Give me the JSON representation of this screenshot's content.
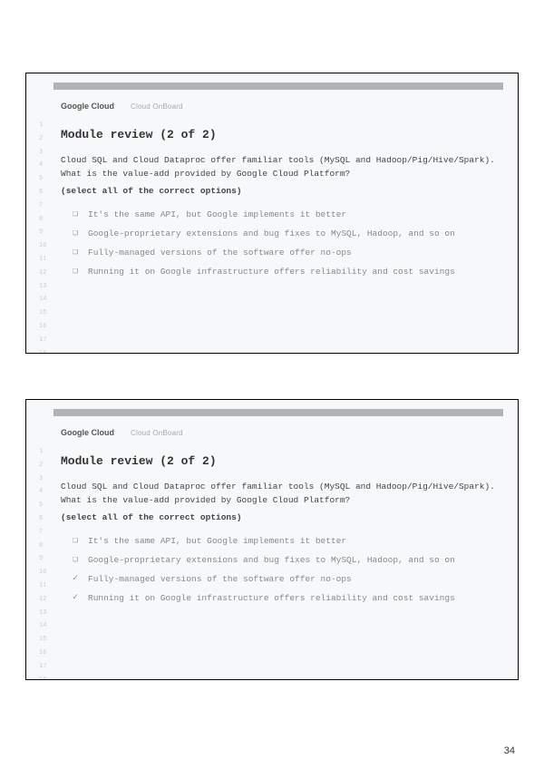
{
  "pageNumber": "34",
  "brand": {
    "main": "Google Cloud",
    "sub": "Cloud OnBoard"
  },
  "slide1": {
    "title": "Module review (2 of 2)",
    "question": "Cloud SQL and Cloud Dataproc offer familiar tools (MySQL and Hadoop/Pig/Hive/Spark). What is the value-add provided by Google Cloud Platform?",
    "instruction": "(select all of the correct options)",
    "options": [
      {
        "marker": "❏",
        "text": "It's the same API, but Google implements it better"
      },
      {
        "marker": "❏",
        "text": "Google-proprietary extensions and bug fixes to MySQL, Hadoop, and so on"
      },
      {
        "marker": "❏",
        "text": "Fully-managed versions of the software offer no-ops"
      },
      {
        "marker": "❏",
        "text": "Running it on Google infrastructure offers reliability and cost savings"
      }
    ]
  },
  "slide2": {
    "title": "Module review (2 of 2)",
    "question": "Cloud SQL and Cloud Dataproc offer familiar tools (MySQL and Hadoop/Pig/Hive/Spark). What is the value-add provided by Google Cloud Platform?",
    "instruction": "(select all of the correct options)",
    "options": [
      {
        "marker": "❏",
        "text": "It's the same API, but Google implements it better"
      },
      {
        "marker": "❏",
        "text": "Google-proprietary extensions and bug fixes to MySQL, Hadoop, and so on"
      },
      {
        "marker": "✓",
        "text": "Fully-managed versions of the software offer no-ops"
      },
      {
        "marker": "✓",
        "text": "Running it on Google infrastructure offers reliability and cost savings"
      }
    ]
  }
}
